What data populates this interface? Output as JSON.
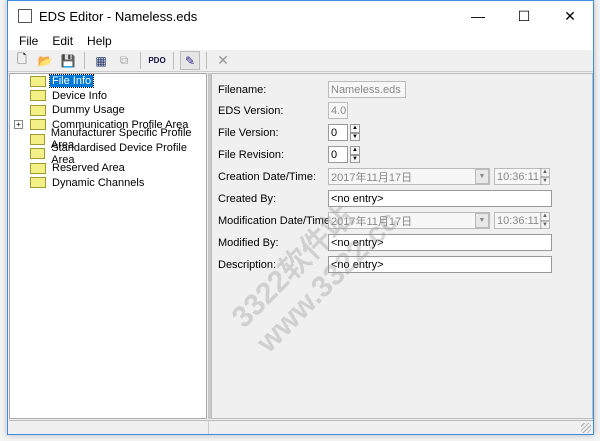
{
  "window": {
    "title": "EDS Editor - Nameless.eds",
    "minimize": "—",
    "maximize": "☐",
    "close": "✕"
  },
  "menu": [
    "File",
    "Edit",
    "Help"
  ],
  "toolbar": [
    {
      "icon": "new-file-icon",
      "glyph": "🗋"
    },
    {
      "icon": "open-folder-icon",
      "glyph": "📂"
    },
    {
      "icon": "save-icon",
      "glyph": "💾"
    },
    {
      "icon": "add-object-icon",
      "glyph": "▦"
    },
    {
      "icon": "copy-icon",
      "glyph": "⧉"
    },
    {
      "icon": "pdo-icon",
      "glyph": "PDO"
    },
    {
      "icon": "edit-object-icon",
      "glyph": "✎"
    },
    {
      "icon": "delete-icon",
      "glyph": "✕"
    }
  ],
  "tree": [
    {
      "label": "File Info",
      "selected": true
    },
    {
      "label": "Device Info"
    },
    {
      "label": "Dummy Usage"
    },
    {
      "label": "Communication Profile Area",
      "expandable": true
    },
    {
      "label": "Manufacturer Specific Profile Area"
    },
    {
      "label": "Standardised Device Profile Area"
    },
    {
      "label": "Reserved Area"
    },
    {
      "label": "Dynamic Channels"
    }
  ],
  "form": {
    "filename": {
      "label": "Filename:",
      "value": "Nameless.eds"
    },
    "eds_version": {
      "label": "EDS Version:",
      "value": "4.0"
    },
    "file_version": {
      "label": "File Version:",
      "value": "0"
    },
    "file_revision": {
      "label": "File Revision:",
      "value": "0"
    },
    "creation": {
      "label": "Creation Date/Time:",
      "date": "2017年11月17日",
      "time": "10:36:11"
    },
    "created_by": {
      "label": "Created By:",
      "value": "<no entry>"
    },
    "modification": {
      "label": "Modification Date/Time:",
      "date": "2017年11月17日",
      "time": "10:36:11"
    },
    "modified_by": {
      "label": "Modified By:",
      "value": "<no entry>"
    },
    "description": {
      "label": "Description:",
      "value": "<no entry>"
    }
  },
  "watermark": "3322软件站 www.3322.cc"
}
